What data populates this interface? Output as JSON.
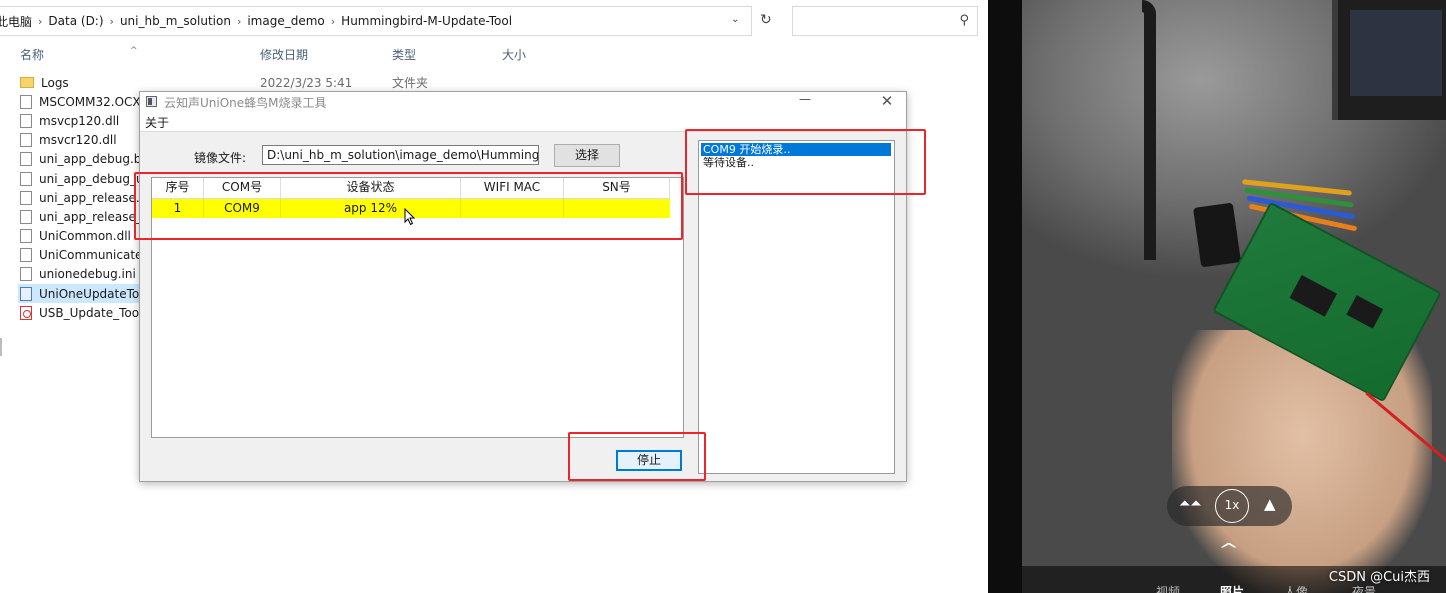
{
  "explorer": {
    "breadcrumb": [
      "此电脑",
      "Data (D:)",
      "uni_hb_m_solution",
      "image_demo",
      "Hummingbird-M-Update-Tool"
    ],
    "columns": {
      "name": "名称",
      "date": "修改日期",
      "type": "类型",
      "size": "大小"
    },
    "files": [
      {
        "name": "Logs",
        "icon": "folder-icon",
        "date": "2022/3/23 5:41",
        "type": "文件夹"
      },
      {
        "name": "MSCOMM32.OCX",
        "icon": "file-icon"
      },
      {
        "name": "msvcp120.dll",
        "icon": "file-icon"
      },
      {
        "name": "msvcr120.dll",
        "icon": "file-icon"
      },
      {
        "name": "uni_app_debug.bin",
        "icon": "file-icon"
      },
      {
        "name": "uni_app_debug_up",
        "icon": "file-icon"
      },
      {
        "name": "uni_app_release.bi",
        "icon": "file-icon"
      },
      {
        "name": "uni_app_release_u",
        "icon": "file-icon"
      },
      {
        "name": "UniCommon.dll",
        "icon": "file-icon"
      },
      {
        "name": "UniCommunicateSv",
        "icon": "file-icon"
      },
      {
        "name": "unionedebug.ini",
        "icon": "file-icon"
      },
      {
        "name": "UniOneUpdateToo",
        "icon": "exe-icon",
        "selected": true
      },
      {
        "name": "USB_Update_Tool_",
        "icon": "pdf-icon"
      }
    ]
  },
  "dialog": {
    "title": "云知声UniOne蜂鸟M烧录工具",
    "menu_about": "关于",
    "image_label": "镜像文件:",
    "image_path": "D:\\uni_hb_m_solution\\image_demo\\Hummingbird-M-U",
    "select_label": "选择",
    "table": {
      "headers": [
        "序号",
        "COM号",
        "设备状态",
        "WIFI MAC",
        "SN号"
      ],
      "rows": [
        {
          "index": "1",
          "com": "COM9",
          "status": "app 12%",
          "mac": "",
          "sn": ""
        }
      ],
      "row_highlight": "#ffff00"
    },
    "log_lines": [
      "COM9 开始烧录..",
      "等待设备.."
    ],
    "stop_label": "停止"
  },
  "annotation_color": "#e8262b",
  "video": {
    "zoom_label": "1x",
    "modes": [
      "视频",
      "照片",
      "人像",
      "夜景"
    ],
    "active_mode": "照片",
    "watermark": "CSDN @Cui杰西"
  }
}
